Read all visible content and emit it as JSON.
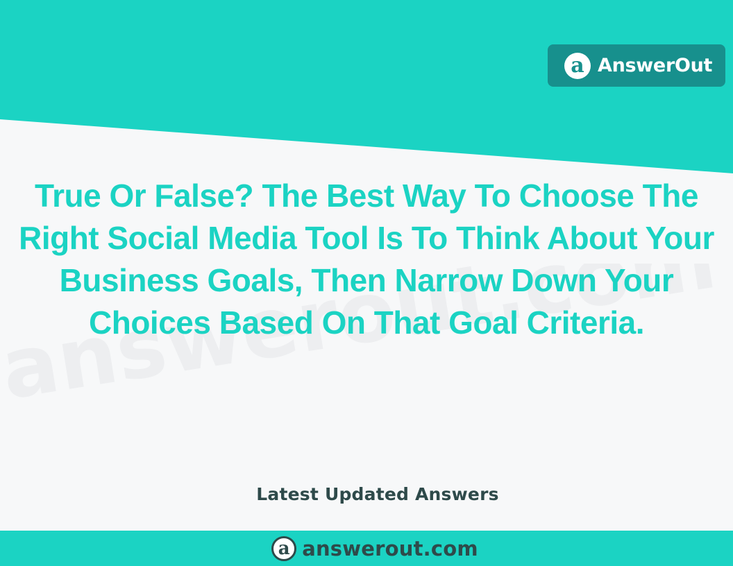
{
  "colors": {
    "teal": "#1bd3c3",
    "badge": "#17908d",
    "dark_text": "#2e4a4a",
    "background": "#f7f8f9"
  },
  "brand": {
    "logo_glyph": "a",
    "name": "AnswerOut"
  },
  "question": {
    "title": "True Or False? The Best Way To Choose The Right Social Media Tool Is To Think About Your Business Goals, Then Narrow Down Your Choices Based On That Goal Criteria."
  },
  "subtitle": "Latest Updated Answers",
  "watermark": {
    "text": "answerout.com"
  },
  "footer": {
    "logo_glyph": "a",
    "url": "answerout.com"
  }
}
